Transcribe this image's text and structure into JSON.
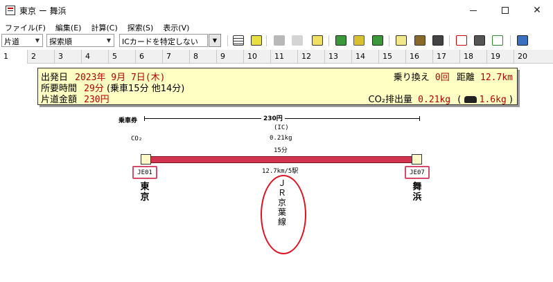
{
  "window": {
    "title": "東京 ー 舞浜"
  },
  "menu": [
    {
      "label": "ファイル(F)"
    },
    {
      "label": "編集(E)"
    },
    {
      "label": "計算(C)"
    },
    {
      "label": "探索(S)"
    },
    {
      "label": "表示(V)"
    }
  ],
  "toolbar": {
    "trip_type": "片道",
    "sort_order": "探索順",
    "ic_card": "ICカードを特定しない",
    "icons": [
      "list-icon",
      "calendar-icon",
      "e-icon",
      "ex-icon",
      "route-icon",
      "map-icon",
      "train-map-icon",
      "train-map-alt-icon",
      "ticket-icon",
      "print-icon",
      "printer-setup-icon",
      "back-icon",
      "find-icon",
      "forward-icon",
      "edit-icon"
    ]
  },
  "tabs": [
    "1",
    "2",
    "3",
    "4",
    "5",
    "6",
    "7",
    "8",
    "9",
    "10",
    "11",
    "12",
    "13",
    "14",
    "15",
    "16",
    "17",
    "18",
    "19",
    "20"
  ],
  "summary": {
    "departure_label": "出発日",
    "departure_value": "2023年 9月 7日(木)",
    "duration_label": "所要時間",
    "duration_value": "29分",
    "duration_detail": "(乗車15分 他14分)",
    "fare_label": "片道金額",
    "fare_value": "230円",
    "transfer_label": "乗り換え",
    "transfer_value": "0回",
    "distance_label": "距離",
    "distance_value": "12.7km",
    "co2_label": "CO₂排出量",
    "co2_value": "0.21kg",
    "car_value": "1.6kg",
    "paren_open": "(",
    "paren_close": ")"
  },
  "route": {
    "ticket_label": "乗車券",
    "fare": "230円",
    "co2_label": "CO₂",
    "ic": "(IC)",
    "co2": "0.21kg",
    "minutes": "15分",
    "distance": "12.7km/5駅",
    "from": {
      "code": "JE01",
      "name": "東京"
    },
    "to": {
      "code": "JE07",
      "name": "舞浜"
    },
    "line": "ＪＲ京葉線"
  }
}
